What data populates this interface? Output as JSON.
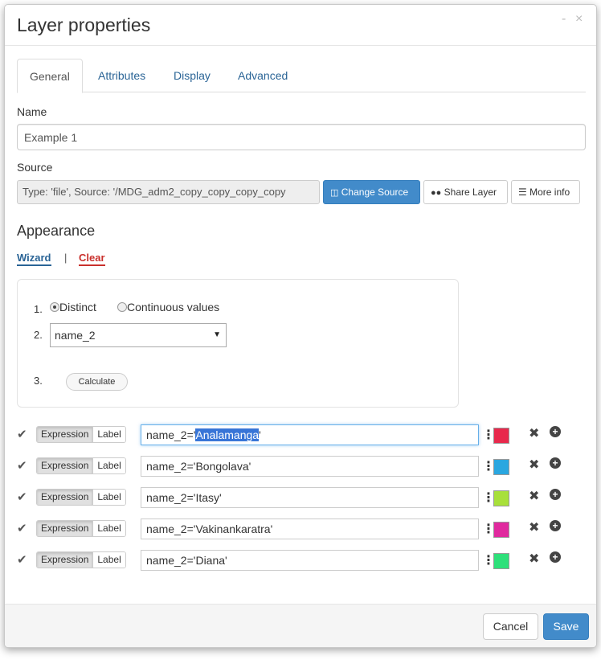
{
  "header": {
    "title": "Layer properties",
    "minimize_icon": "minimize-icon",
    "close_icon": "close-icon",
    "minimize_glyph": "-",
    "close_glyph": "×"
  },
  "tabs": [
    {
      "label": "General",
      "active": true
    },
    {
      "label": "Attributes",
      "active": false
    },
    {
      "label": "Display",
      "active": false
    },
    {
      "label": "Advanced",
      "active": false
    }
  ],
  "general": {
    "name_label": "Name",
    "name_value": "Example 1",
    "source_label": "Source",
    "source_value": "Type: 'file', Source: '/MDG_adm2_copy_copy_copy_copy",
    "change_source_label": "Change Source",
    "share_layer_label": "Share Layer",
    "more_info_label": "More info"
  },
  "appearance": {
    "title": "Appearance",
    "wizard_link": "Wizard",
    "separator": "|",
    "clear_link": "Clear",
    "steps": {
      "step1": "1.",
      "step2": "2.",
      "step3": "3.",
      "distinct_label": "Distinct",
      "continuous_label": "Continuous values",
      "selected_field": "name_2",
      "calculate_label": "Calculate"
    }
  },
  "rules": [
    {
      "prefix": "name_2='",
      "value": "Analamanga",
      "suffix": "'",
      "color": "#e8294c",
      "focused": true
    },
    {
      "prefix": "name_2='",
      "value": "Bongolava",
      "suffix": "'",
      "color": "#2aa7e0",
      "focused": false
    },
    {
      "prefix": "name_2='",
      "value": "Itasy",
      "suffix": "'",
      "color": "#a8e03a",
      "focused": false
    },
    {
      "prefix": "name_2='",
      "value": "Vakinankaratra",
      "suffix": "'",
      "color": "#e0299e",
      "focused": false
    },
    {
      "prefix": "name_2='",
      "value": "Diana",
      "suffix": "'",
      "color": "#2ee07a",
      "focused": false
    }
  ],
  "rule_toggle": {
    "expression": "Expression",
    "label": "Label"
  },
  "footer": {
    "cancel_label": "Cancel",
    "save_label": "Save"
  },
  "colors": {
    "primary": "#428bca",
    "link": "#2a6496",
    "danger": "#c9302c"
  }
}
